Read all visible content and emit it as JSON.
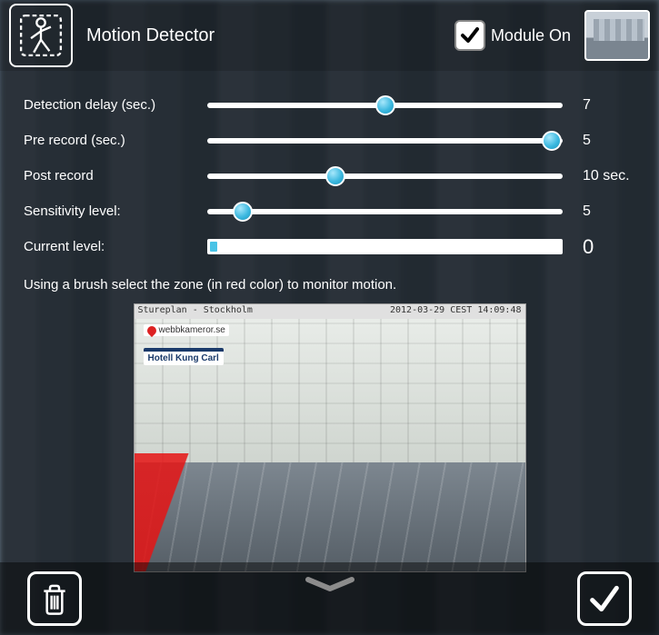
{
  "header": {
    "title": "Motion Detector",
    "module_label": "Module On",
    "module_on": true
  },
  "sliders": {
    "detection_delay": {
      "label": "Detection delay (sec.)",
      "value": "7",
      "percent": 50
    },
    "pre_record": {
      "label": "Pre record (sec.)",
      "value": "5",
      "percent": 97
    },
    "post_record": {
      "label": "Post record",
      "value": "10 sec.",
      "percent": 36
    },
    "sensitivity": {
      "label": "Sensitivity level:",
      "value": "5",
      "percent": 10
    },
    "current_level": {
      "label": "Current level:",
      "value": "0",
      "percent": 2
    }
  },
  "hint": "Using a brush select the zone (in red color) to monitor motion.",
  "preview": {
    "caption_left": "Stureplan - Stockholm",
    "caption_right": "2012-03-29 CEST 14:09:48",
    "logo1": "webbkameror.se",
    "logo2": "Hotell Kung Carl"
  },
  "colors": {
    "accent": "#3db9e0",
    "zone": "#e61414"
  }
}
